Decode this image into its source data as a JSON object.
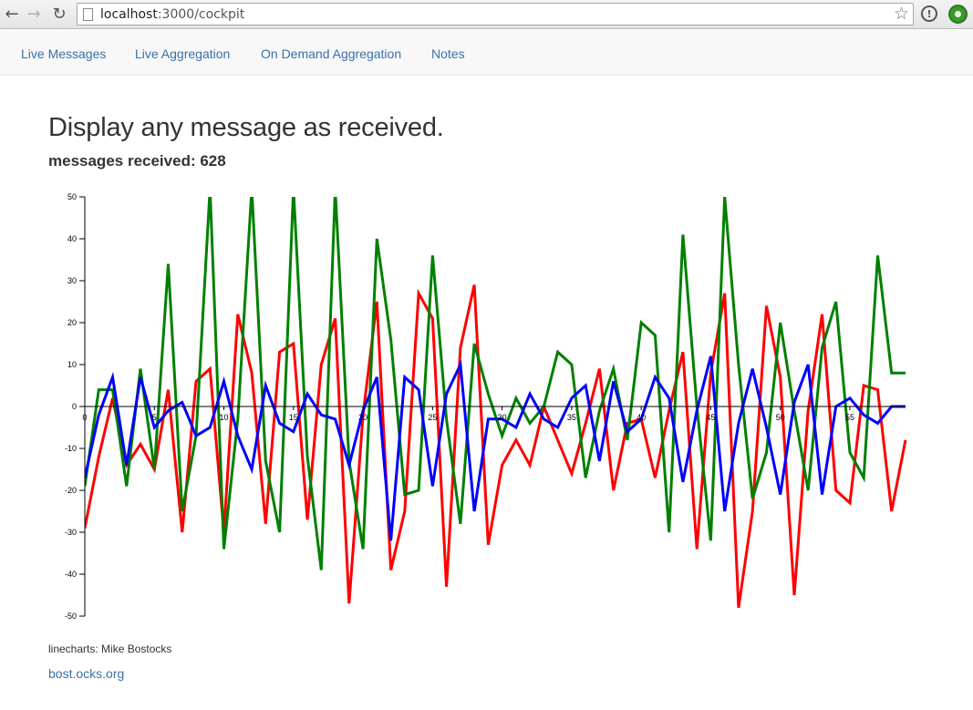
{
  "browser": {
    "url_host": "localhost",
    "url_path": ":3000/cockpit"
  },
  "nav": {
    "items": [
      "Live Messages",
      "Live Aggregation",
      "On Demand Aggregation",
      "Notes"
    ]
  },
  "page": {
    "title": "Display any message as received.",
    "count_label": "messages received:",
    "count_value": "628",
    "credit": "linecharts: Mike Bostocks",
    "credit_link": "bost.ocks.org"
  },
  "colors": {
    "series_red": "#ff0000",
    "series_green": "#008000",
    "series_blue": "#0000ff",
    "link": "#3a71a8"
  },
  "chart_data": {
    "type": "line",
    "title": "",
    "xlabel": "",
    "ylabel": "",
    "xlim": [
      0,
      59
    ],
    "ylim": [
      -50,
      50
    ],
    "xticks": [
      0,
      5,
      10,
      15,
      20,
      25,
      30,
      35,
      40,
      45,
      50,
      55
    ],
    "yticks": [
      -50,
      -40,
      -30,
      -20,
      -10,
      0,
      10,
      20,
      30,
      40,
      50
    ],
    "grid": false,
    "series": [
      {
        "color": "#ff0000",
        "values": [
          -29,
          -12,
          2,
          -14,
          -9,
          -15,
          4,
          -30,
          6,
          9,
          -30,
          22,
          8,
          -28,
          13,
          15,
          -27,
          10,
          21,
          -47,
          -2,
          25,
          -39,
          -25,
          27,
          21,
          -43,
          14,
          29,
          -33,
          -14,
          -8,
          -14,
          0,
          -8,
          -16,
          -4,
          9,
          -20,
          -4,
          -3,
          -17,
          -1,
          13,
          -34,
          8,
          27,
          -48,
          -25,
          24,
          7,
          -45,
          -1,
          22,
          -20,
          -23,
          5,
          4,
          -25,
          -8
        ]
      },
      {
        "color": "#008000",
        "values": [
          -19,
          4,
          4,
          -19,
          9,
          -15,
          34,
          -25,
          -7,
          52,
          -34,
          -3,
          52,
          -13,
          -30,
          52,
          -12,
          -39,
          52,
          -13,
          -34,
          40,
          16,
          -21,
          -20,
          36,
          -3,
          -28,
          15,
          3,
          -7,
          2,
          -4,
          0,
          13,
          10,
          -17,
          -1,
          9,
          -8,
          20,
          17,
          -30,
          41,
          0,
          -32,
          50,
          10,
          -22,
          -11,
          20,
          -1,
          -20,
          14,
          25,
          -11,
          -17,
          36,
          8,
          8
        ]
      },
      {
        "color": "#0000ff",
        "values": [
          -17,
          -2,
          7,
          -14,
          7,
          -5,
          -1,
          1,
          -7,
          -5,
          6,
          -7,
          -15,
          5,
          -4,
          -6,
          3,
          -2,
          -3,
          -14,
          -1,
          7,
          -32,
          7,
          4,
          -19,
          3,
          10,
          -25,
          -3,
          -3,
          -5,
          3,
          -3,
          -5,
          2,
          5,
          -13,
          6,
          -6,
          -3,
          7,
          2,
          -18,
          -1,
          12,
          -25,
          -4,
          9,
          -5,
          -21,
          1,
          10,
          -21,
          0,
          2,
          -2,
          -4,
          0,
          0
        ]
      }
    ]
  }
}
